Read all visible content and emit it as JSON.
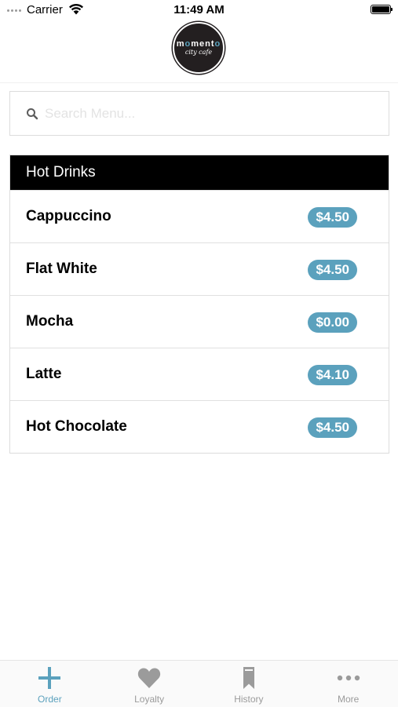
{
  "status_bar": {
    "carrier": "Carrier",
    "time": "11:49 AM"
  },
  "header": {
    "logo_text_part1": "m",
    "logo_text_o1": "o",
    "logo_text_part2": "ment",
    "logo_text_o2": "o",
    "logo_subtext": "city cafe"
  },
  "search": {
    "placeholder": "Search Menu..."
  },
  "menu": {
    "category": "Hot Drinks",
    "items": [
      {
        "name": "Cappuccino",
        "price": "$4.50"
      },
      {
        "name": "Flat White",
        "price": "$4.50"
      },
      {
        "name": "Mocha",
        "price": "$0.00"
      },
      {
        "name": "Latte",
        "price": "$4.10"
      },
      {
        "name": "Hot Chocolate",
        "price": "$4.50"
      }
    ]
  },
  "tab_bar": {
    "active": "order",
    "tabs": [
      {
        "label": "Order",
        "icon": "plus-icon"
      },
      {
        "label": "Loyalty",
        "icon": "heart-icon"
      },
      {
        "label": "History",
        "icon": "bookmark-icon"
      },
      {
        "label": "More",
        "icon": "more-icon"
      }
    ]
  },
  "colors": {
    "accent": "#5ba1bd",
    "header_bg": "#000000",
    "inactive": "#9b9b9b"
  }
}
